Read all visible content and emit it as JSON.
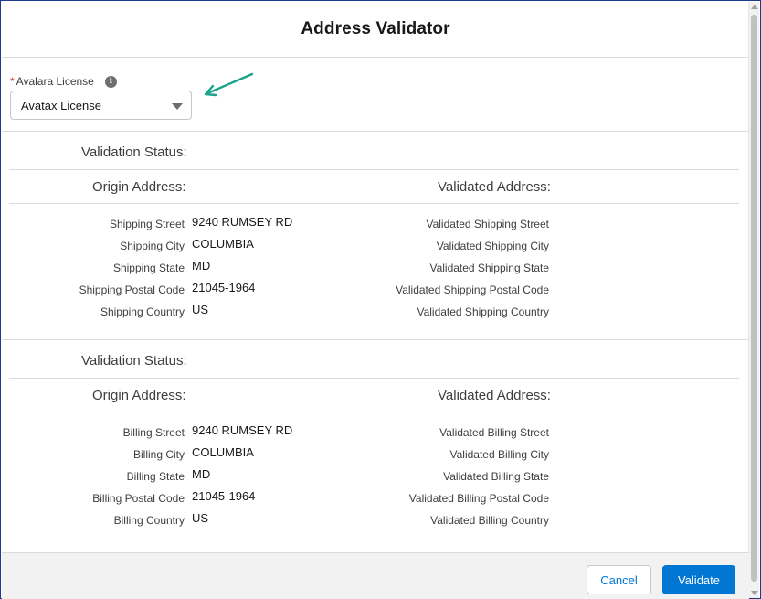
{
  "modal": {
    "title": "Address Validator"
  },
  "license": {
    "label": "Avalara License",
    "required_marker": "*",
    "info_glyph": "i",
    "selected": "Avatax License"
  },
  "shipping": {
    "status_label": "Validation Status:",
    "origin_heading": "Origin Address:",
    "validated_heading": "Validated Address:",
    "fields": [
      {
        "label": "Shipping Street",
        "value": "9240 RUMSEY RD",
        "validated_label": "Validated Shipping Street"
      },
      {
        "label": "Shipping City",
        "value": "COLUMBIA",
        "validated_label": "Validated Shipping City"
      },
      {
        "label": "Shipping State",
        "value": "MD",
        "validated_label": "Validated Shipping State"
      },
      {
        "label": "Shipping Postal Code",
        "value": "21045-1964",
        "validated_label": "Validated Shipping Postal Code"
      },
      {
        "label": "Shipping Country",
        "value": "US",
        "validated_label": "Validated Shipping Country"
      }
    ]
  },
  "billing": {
    "status_label": "Validation Status:",
    "origin_heading": "Origin Address:",
    "validated_heading": "Validated Address:",
    "fields": [
      {
        "label": "Billing Street",
        "value": "9240 RUMSEY RD",
        "validated_label": "Validated Billing Street"
      },
      {
        "label": "Billing City",
        "value": "COLUMBIA",
        "validated_label": "Validated Billing City"
      },
      {
        "label": "Billing State",
        "value": "MD",
        "validated_label": "Validated Billing State"
      },
      {
        "label": "Billing Postal Code",
        "value": "21045-1964",
        "validated_label": "Validated Billing Postal Code"
      },
      {
        "label": "Billing Country",
        "value": "US",
        "validated_label": "Validated Billing Country"
      }
    ]
  },
  "footer": {
    "cancel_label": "Cancel",
    "validate_label": "Validate"
  },
  "colors": {
    "brand": "#0176d3",
    "annotation": "#1aa38a",
    "required": "#c23934"
  }
}
